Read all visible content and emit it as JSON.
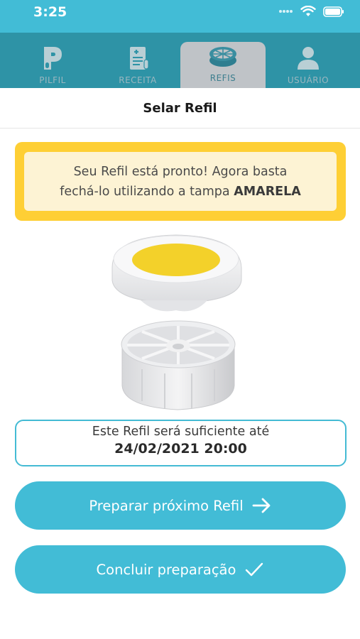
{
  "status_bar": {
    "time": "3:25"
  },
  "tabs": [
    {
      "label": "PILFIL",
      "icon": "pilfil-p-icon",
      "active": false
    },
    {
      "label": "RECEITA",
      "icon": "prescription-icon",
      "active": false
    },
    {
      "label": "REFIS",
      "icon": "refill-pillbox-icon",
      "active": true
    },
    {
      "label": "USUÁRIO",
      "icon": "user-icon",
      "active": false
    }
  ],
  "header": {
    "title": "Selar Refil"
  },
  "notice": {
    "line1": "Seu Refil está pronto! Agora basta",
    "line2_prefix": "fechá-lo utilizando a tampa ",
    "line2_bold": "AMARELA"
  },
  "sufficiency": {
    "label": "Este Refil será suficiente até",
    "datetime": "24/02/2021 20:00"
  },
  "buttons": {
    "next_label": "Preparar próximo Refil",
    "finish_label": "Concluir preparação"
  },
  "colors": {
    "primary": "#42bcd6",
    "tab_bar": "#2e93a6",
    "notice_border": "#fecf35",
    "notice_fill": "#fdf3d4",
    "lid_yellow": "#f6d21e"
  }
}
